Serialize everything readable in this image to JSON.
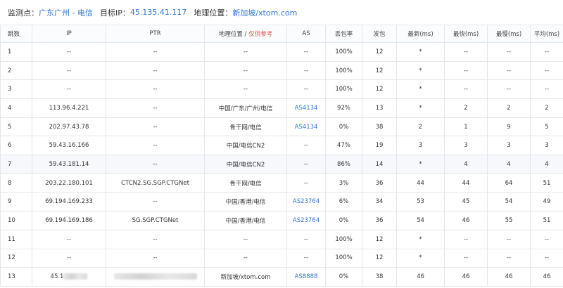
{
  "header": {
    "monitor_label": "监测点：",
    "monitor_value": "广东广州 - 电信",
    "target_label": "目标IP：",
    "target_value": "45.135.41.117",
    "location_label": "地理位置：",
    "location_value": "新加坡/xtom.com"
  },
  "columns": {
    "hop": "跳数",
    "ip": "IP",
    "ptr": "PTR",
    "geo": "地理位置 / ",
    "geo_note": "仅供参考",
    "as": "AS",
    "loss": "丢包率",
    "sent": "发包",
    "last": "最新(ms)",
    "best": "最快(ms)",
    "worst": "最慢(ms)",
    "avg": "平均(ms)"
  },
  "rows": [
    {
      "hop": "1",
      "ip": "--",
      "ptr": "--",
      "geo": "--",
      "as": "--",
      "loss": "100%",
      "sent": "12",
      "last": "*",
      "best": "--",
      "worst": "--",
      "avg": "--"
    },
    {
      "hop": "2",
      "ip": "--",
      "ptr": "--",
      "geo": "--",
      "as": "--",
      "loss": "100%",
      "sent": "12",
      "last": "*",
      "best": "--",
      "worst": "--",
      "avg": "--"
    },
    {
      "hop": "3",
      "ip": "--",
      "ptr": "--",
      "geo": "--",
      "as": "--",
      "loss": "100%",
      "sent": "12",
      "last": "*",
      "best": "--",
      "worst": "--",
      "avg": "--"
    },
    {
      "hop": "4",
      "ip": "113.96.4.221",
      "ptr": "--",
      "geo": "中国/广东/广州/电信",
      "as": "AS4134",
      "loss": "92%",
      "sent": "13",
      "last": "*",
      "best": "2",
      "worst": "2",
      "avg": "2"
    },
    {
      "hop": "5",
      "ip": "202.97.43.78",
      "ptr": "--",
      "geo": "骨干网/电信",
      "as": "AS4134",
      "loss": "0%",
      "sent": "38",
      "last": "2",
      "best": "1",
      "worst": "9",
      "avg": "5"
    },
    {
      "hop": "6",
      "ip": "59.43.16.166",
      "ptr": "--",
      "geo": "中国/电信CN2",
      "as": "--",
      "loss": "47%",
      "sent": "19",
      "last": "3",
      "best": "3",
      "worst": "3",
      "avg": "3"
    },
    {
      "hop": "7",
      "ip": "59.43.181.14",
      "ptr": "--",
      "geo": "中国/电信CN2",
      "as": "--",
      "loss": "86%",
      "sent": "14",
      "last": "*",
      "best": "4",
      "worst": "4",
      "avg": "4"
    },
    {
      "hop": "8",
      "ip": "203.22.180.101",
      "ptr": "CTCN2.SG.SGP.CTGNet",
      "geo": "骨干网/电信",
      "as": "--",
      "loss": "3%",
      "sent": "36",
      "last": "44",
      "best": "44",
      "worst": "64",
      "avg": "51"
    },
    {
      "hop": "9",
      "ip": "69.194.169.233",
      "ptr": "--",
      "geo": "中国/香港/电信",
      "as": "AS23764",
      "loss": "6%",
      "sent": "34",
      "last": "53",
      "best": "45",
      "worst": "54",
      "avg": "49"
    },
    {
      "hop": "10",
      "ip": "69.194.169.186",
      "ptr": "SG.SGP.CTGNet",
      "geo": "中国/香港/电信",
      "as": "AS23764",
      "loss": "0%",
      "sent": "36",
      "last": "54",
      "best": "46",
      "worst": "55",
      "avg": "51"
    },
    {
      "hop": "11",
      "ip": "--",
      "ptr": "--",
      "geo": "--",
      "as": "--",
      "loss": "100%",
      "sent": "12",
      "last": "*",
      "best": "--",
      "worst": "--",
      "avg": "--"
    },
    {
      "hop": "12",
      "ip": "--",
      "ptr": "--",
      "geo": "--",
      "as": "--",
      "loss": "100%",
      "sent": "12",
      "last": "*",
      "best": "--",
      "worst": "--",
      "avg": "--"
    },
    {
      "hop": "13",
      "ip": "45.1",
      "ptr": "",
      "geo": "新加坡/xtom.com",
      "as": "AS8888",
      "loss": "0%",
      "sent": "38",
      "last": "46",
      "best": "46",
      "worst": "46",
      "avg": "46"
    }
  ]
}
